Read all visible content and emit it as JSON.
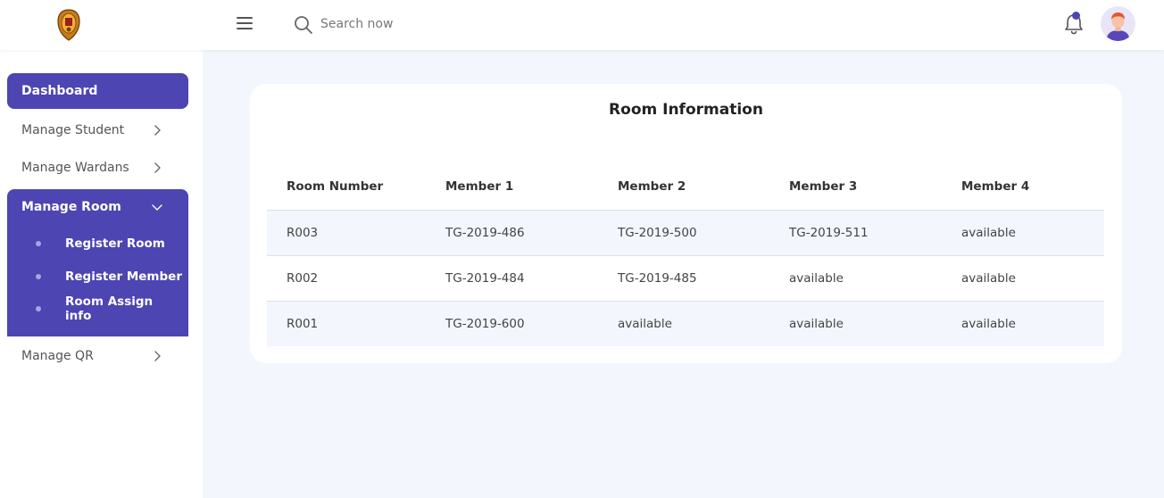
{
  "header": {
    "search_placeholder": "Search now"
  },
  "sidebar": {
    "dashboard": "Dashboard",
    "manage_student": "Manage Student",
    "manage_wardens": "Manage Wardans",
    "manage_room": "Manage Room",
    "room_sub_items": [
      "Register Room",
      "Register Member",
      "Room Assign info"
    ],
    "manage_qr": "Manage QR"
  },
  "card": {
    "title": "Room Information",
    "columns": [
      "Room Number",
      "Member 1",
      "Member 2",
      "Member 3",
      "Member 4"
    ],
    "rows": [
      [
        "R003",
        "TG-2019-486",
        "TG-2019-500",
        "TG-2019-511",
        "available"
      ],
      [
        "R002",
        "TG-2019-484",
        "TG-2019-485",
        "available",
        "available"
      ],
      [
        "R001",
        "TG-2019-600",
        "available",
        "available",
        "available"
      ]
    ]
  },
  "colors": {
    "accent": "#4c45b2",
    "background": "#f3f6fd"
  },
  "icons": {
    "logo": "university-crest-logo",
    "menu": "hamburger-menu-icon",
    "search": "search-icon",
    "notification": "bell-icon",
    "profile": "user-avatar"
  }
}
